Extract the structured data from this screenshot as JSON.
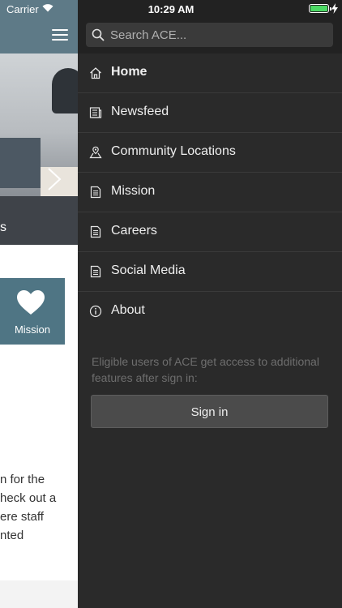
{
  "status_bar": {
    "carrier": "Carrier",
    "time": "10:29 AM"
  },
  "background_page": {
    "hero_caption_partial": "s",
    "tile": {
      "label": "Mission",
      "icon": "heart-icon"
    },
    "paragraph_lines": [
      "n for the",
      "heck out a",
      "ere staff",
      "nted"
    ]
  },
  "drawer": {
    "search": {
      "placeholder": "Search ACE..."
    },
    "menu": [
      {
        "label": "Home",
        "icon": "home-icon",
        "active": true
      },
      {
        "label": "Newsfeed",
        "icon": "newsfeed-icon"
      },
      {
        "label": "Community Locations",
        "icon": "map-pin-icon"
      },
      {
        "label": "Mission",
        "icon": "document-icon"
      },
      {
        "label": "Careers",
        "icon": "document-icon"
      },
      {
        "label": "Social Media",
        "icon": "document-icon"
      },
      {
        "label": "About",
        "icon": "info-icon"
      }
    ],
    "signin_note": "Eligible users of ACE get access to additional features after sign in:",
    "signin_label": "Sign in"
  },
  "colors": {
    "drawer_bg": "#2a2a2a",
    "header_teal": "#5e7a87",
    "tile_teal": "#4f7584",
    "battery_green": "#4cd964"
  }
}
